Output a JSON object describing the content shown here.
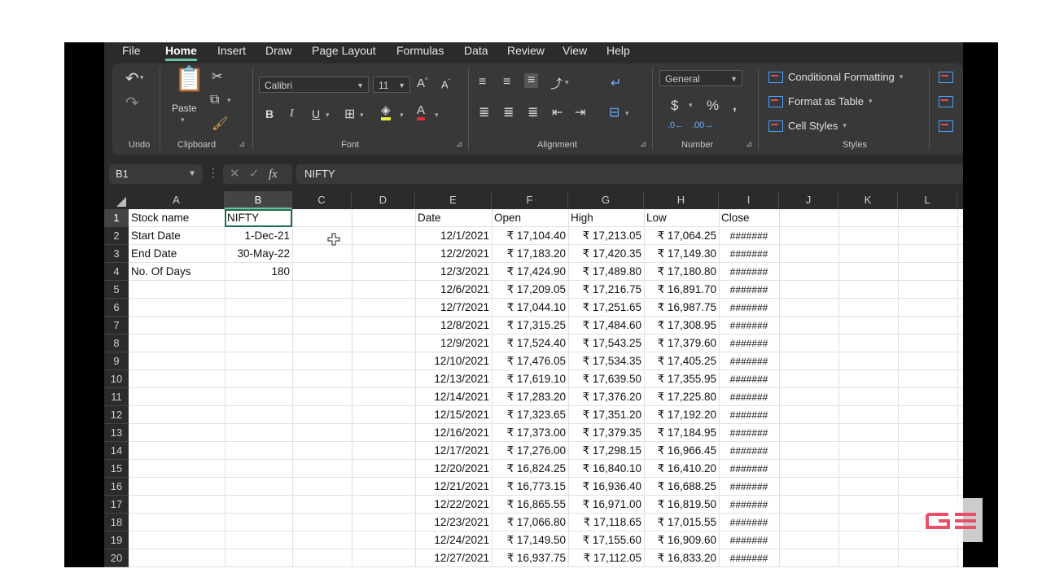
{
  "menu_tabs": [
    "File",
    "Home",
    "Insert",
    "Draw",
    "Page Layout",
    "Formulas",
    "Data",
    "Review",
    "View",
    "Help"
  ],
  "active_tab": "Home",
  "ribbon": {
    "groups": [
      "Undo",
      "Clipboard",
      "Font",
      "Alignment",
      "Number",
      "Styles"
    ],
    "paste_label": "Paste",
    "font_name": "Calibri",
    "font_size": "11",
    "number_format": "General",
    "styles": [
      "Conditional Formatting",
      "Format as Table",
      "Cell Styles"
    ]
  },
  "formula_bar": {
    "name_box": "B1",
    "fx": "fx",
    "content": "NIFTY"
  },
  "columns": [
    "A",
    "B",
    "C",
    "D",
    "E",
    "F",
    "G",
    "H",
    "I",
    "J",
    "K",
    "L"
  ],
  "rows": [
    "1",
    "2",
    "3",
    "4",
    "5",
    "6",
    "7",
    "8",
    "9",
    "10",
    "11",
    "12",
    "13",
    "14",
    "15",
    "16",
    "17",
    "18",
    "19",
    "20"
  ],
  "info": [
    {
      "label": "Stock name",
      "value": "NIFTY"
    },
    {
      "label": "Start Date",
      "value": "1-Dec-21"
    },
    {
      "label": "End Date",
      "value": "30-May-22"
    },
    {
      "label": "No. Of Days",
      "value": "180"
    }
  ],
  "table_headers": [
    "Date",
    "Open",
    "High",
    "Low",
    "Close"
  ],
  "table_rows": [
    [
      "12/1/2021",
      "₹ 17,104.40",
      "₹ 17,213.05",
      "₹ 17,064.25",
      "#######"
    ],
    [
      "12/2/2021",
      "₹ 17,183.20",
      "₹ 17,420.35",
      "₹ 17,149.30",
      "#######"
    ],
    [
      "12/3/2021",
      "₹ 17,424.90",
      "₹ 17,489.80",
      "₹ 17,180.80",
      "#######"
    ],
    [
      "12/6/2021",
      "₹ 17,209.05",
      "₹ 17,216.75",
      "₹ 16,891.70",
      "#######"
    ],
    [
      "12/7/2021",
      "₹ 17,044.10",
      "₹ 17,251.65",
      "₹ 16,987.75",
      "#######"
    ],
    [
      "12/8/2021",
      "₹ 17,315.25",
      "₹ 17,484.60",
      "₹ 17,308.95",
      "#######"
    ],
    [
      "12/9/2021",
      "₹ 17,524.40",
      "₹ 17,543.25",
      "₹ 17,379.60",
      "#######"
    ],
    [
      "12/10/2021",
      "₹ 17,476.05",
      "₹ 17,534.35",
      "₹ 17,405.25",
      "#######"
    ],
    [
      "12/13/2021",
      "₹ 17,619.10",
      "₹ 17,639.50",
      "₹ 17,355.95",
      "#######"
    ],
    [
      "12/14/2021",
      "₹ 17,283.20",
      "₹ 17,376.20",
      "₹ 17,225.80",
      "#######"
    ],
    [
      "12/15/2021",
      "₹ 17,323.65",
      "₹ 17,351.20",
      "₹ 17,192.20",
      "#######"
    ],
    [
      "12/16/2021",
      "₹ 17,373.00",
      "₹ 17,379.35",
      "₹ 17,184.95",
      "#######"
    ],
    [
      "12/17/2021",
      "₹ 17,276.00",
      "₹ 17,298.15",
      "₹ 16,966.45",
      "#######"
    ],
    [
      "12/20/2021",
      "₹ 16,824.25",
      "₹ 16,840.10",
      "₹ 16,410.20",
      "#######"
    ],
    [
      "12/21/2021",
      "₹ 16,773.15",
      "₹ 16,936.40",
      "₹ 16,688.25",
      "#######"
    ],
    [
      "12/22/2021",
      "₹ 16,865.55",
      "₹ 16,971.00",
      "₹ 16,819.50",
      "#######"
    ],
    [
      "12/23/2021",
      "₹ 17,066.80",
      "₹ 17,118.65",
      "₹ 17,015.55",
      "#######"
    ],
    [
      "12/24/2021",
      "₹ 17,149.50",
      "₹ 17,155.60",
      "₹ 16,909.60",
      "#######"
    ],
    [
      "12/27/2021",
      "₹ 16,937.75",
      "₹ 17,112.05",
      "₹ 16,833.20",
      "#######"
    ]
  ],
  "colors": {
    "accent": "#6fc3a6",
    "selection_border": "#1e6e48",
    "app_bg": "#2b2b2b",
    "ribbon_bg": "#383838"
  }
}
